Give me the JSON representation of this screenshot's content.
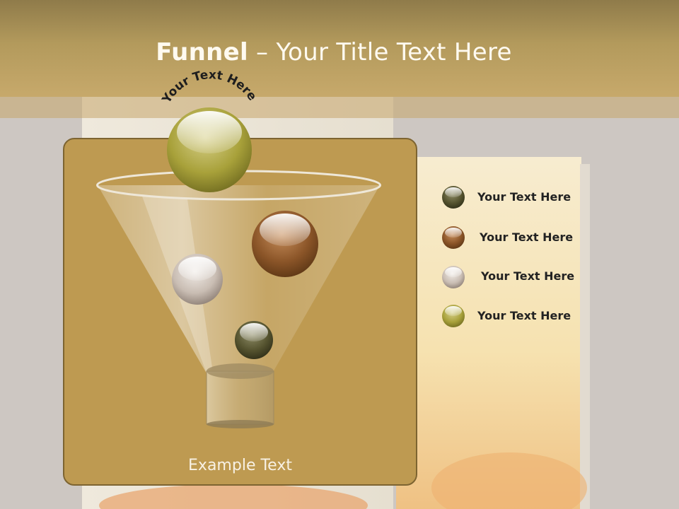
{
  "slide": {
    "title_bold": "Funnel",
    "title_rest": " – Your Title Text Here",
    "arc_text": "Your Text Here",
    "example_text": "Example Text"
  },
  "legend": [
    {
      "label": "Your  Text Here",
      "color": "#4f4d2e",
      "icon": "dark-olive-sphere-icon"
    },
    {
      "label": "Your  Text Here",
      "color": "#7a4a22",
      "icon": "brown-sphere-icon"
    },
    {
      "label": "Your  Text Here",
      "color": "#c9bcb0",
      "icon": "light-gray-sphere-icon"
    },
    {
      "label": "Your  Text Here",
      "color": "#a59a35",
      "icon": "olive-green-sphere-icon"
    }
  ],
  "colors": {
    "header": "#b39a5c",
    "panel": "#be9a51",
    "panel_border": "#7d6431",
    "title_text": "#fffaf0"
  }
}
